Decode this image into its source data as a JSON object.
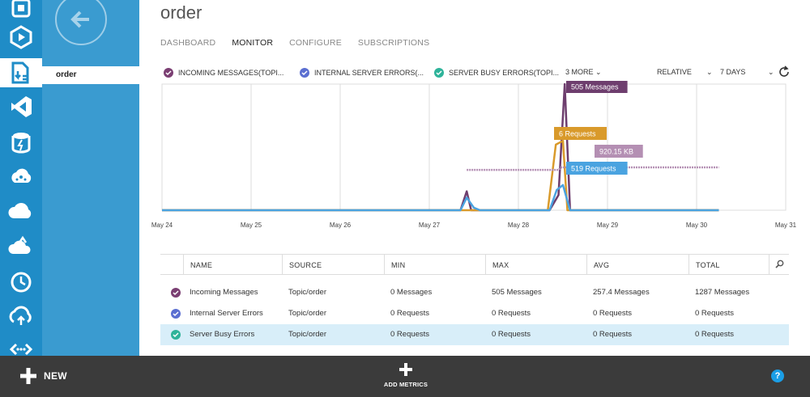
{
  "panel": {
    "item_label": "order"
  },
  "main": {
    "title": "order",
    "tabs": [
      {
        "label": "DASHBOARD",
        "active": false
      },
      {
        "label": "MONITOR",
        "active": true
      },
      {
        "label": "CONFIGURE",
        "active": false
      },
      {
        "label": "SUBSCRIPTIONS",
        "active": false
      }
    ]
  },
  "metric_bar": {
    "chips": [
      {
        "label": "INCOMING MESSAGES(TOPI...",
        "color": "#7b3f73"
      },
      {
        "label": "INTERNAL SERVER ERRORS(...",
        "color": "#5b6fd1"
      },
      {
        "label": "SERVER BUSY ERRORS(TOPI...",
        "color": "#2eb39a"
      }
    ],
    "more": "3 MORE",
    "relative": "RELATIVE",
    "range": "7 DAYS"
  },
  "chart_data": {
    "type": "line",
    "x_labels": [
      "May 24",
      "May 25",
      "May 26",
      "May 27",
      "May 28",
      "May 29",
      "May 30",
      "May 31"
    ],
    "grid": true,
    "callouts": [
      {
        "text": "505 Messages",
        "color": "#6e3e6e"
      },
      {
        "text": "6 Requests",
        "color": "#d99a2b"
      },
      {
        "text": "920.15 KB",
        "color": "#b48fb3"
      },
      {
        "text": "519 Requests",
        "color": "#4aa3e0"
      }
    ],
    "series": [
      {
        "color": "#6e3e6e",
        "points": [
          [
            0,
            0
          ],
          [
            3.35,
            0
          ],
          [
            3.42,
            0.15
          ],
          [
            3.47,
            0
          ],
          [
            4.35,
            0
          ],
          [
            4.45,
            0.12
          ],
          [
            4.52,
            1.0
          ],
          [
            4.58,
            0
          ],
          [
            6.25,
            0
          ]
        ]
      },
      {
        "color": "#d99a2b",
        "points": [
          [
            0,
            0
          ],
          [
            4.33,
            0
          ],
          [
            4.42,
            0.52
          ],
          [
            4.5,
            0.55
          ],
          [
            4.55,
            0
          ],
          [
            6.25,
            0
          ]
        ]
      },
      {
        "color": "#b48fb3",
        "dashed": true,
        "points": [
          [
            3.42,
            0.32
          ],
          [
            4.45,
            0.32
          ],
          [
            4.48,
            0.34
          ],
          [
            6.25,
            0.34
          ]
        ]
      },
      {
        "color": "#4aa3e0",
        "points": [
          [
            0,
            0
          ],
          [
            3.35,
            0
          ],
          [
            3.42,
            0.1
          ],
          [
            3.5,
            0.02
          ],
          [
            3.57,
            0
          ],
          [
            4.35,
            0
          ],
          [
            4.43,
            0.16
          ],
          [
            4.5,
            0.2
          ],
          [
            4.58,
            0
          ],
          [
            6.25,
            0
          ]
        ]
      }
    ]
  },
  "table": {
    "headers": [
      "NAME",
      "SOURCE",
      "MIN",
      "MAX",
      "AVG",
      "TOTAL"
    ],
    "rows": [
      {
        "name": "Incoming Messages",
        "source": "Topic/order",
        "min": "0 Messages",
        "max": "505 Messages",
        "avg": "257.4 Messages",
        "total": "1287 Messages",
        "color": "#7b3f73",
        "selected": false
      },
      {
        "name": "Internal Server Errors",
        "source": "Topic/order",
        "min": "0 Requests",
        "max": "0 Requests",
        "avg": "0 Requests",
        "total": "0 Requests",
        "color": "#5b6fd1",
        "selected": false
      },
      {
        "name": "Server Busy Errors",
        "source": "Topic/order",
        "min": "0 Requests",
        "max": "0 Requests",
        "avg": "0 Requests",
        "total": "0 Requests",
        "color": "#2eb39a",
        "selected": true
      }
    ]
  },
  "bottom_bar": {
    "new_label": "NEW",
    "add_metrics_label": "ADD METRICS",
    "help_label": "?"
  },
  "rail_icons": [
    "service-bus-icon",
    "media-services-icon",
    "service-bus-active-icon",
    "visual-studio-icon",
    "storage-icon",
    "hdinsight-icon",
    "cloud-services-icon",
    "mobile-services-icon",
    "scheduler-icon",
    "backup-icon",
    "api-management-icon"
  ]
}
